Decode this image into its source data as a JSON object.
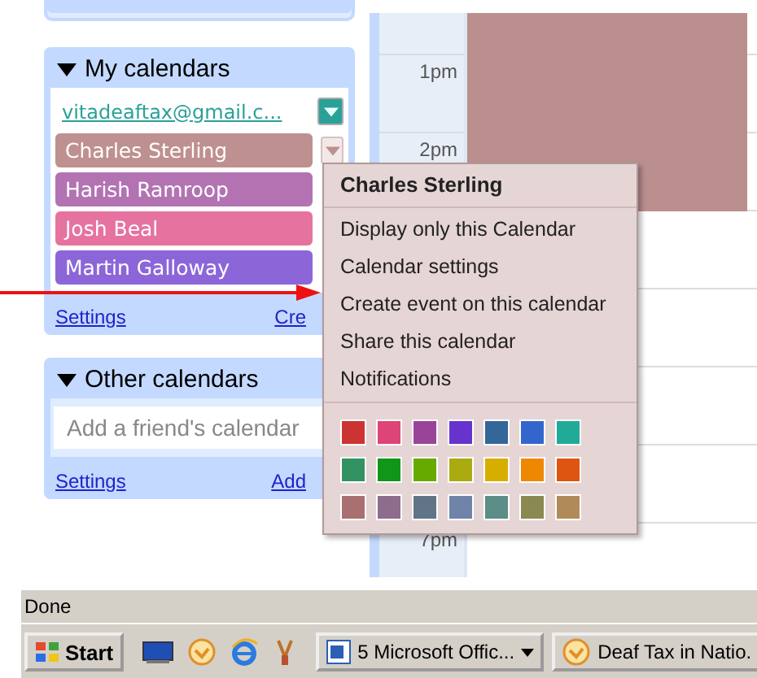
{
  "sidebar": {
    "my_calendars": {
      "title": "My calendars",
      "expanded": true,
      "items": [
        {
          "kind": "link",
          "name": "vitadeaftax@gmail.c...",
          "color": "#2aa198",
          "menu_open": false
        },
        {
          "kind": "chip",
          "name": "Charles Sterling",
          "color": "#bf9090",
          "menu_open": true
        },
        {
          "kind": "chip",
          "name": "Harish Ramroop",
          "color": "#b373b3"
        },
        {
          "kind": "chip",
          "name": "Josh Beal",
          "color": "#e6739f"
        },
        {
          "kind": "chip",
          "name": "Martin Galloway",
          "color": "#8c66d9"
        }
      ],
      "footer_links": [
        "Settings",
        "Cre"
      ]
    },
    "other_calendars": {
      "title": "Other calendars",
      "expanded": true,
      "placeholder": "Add a friend's calendar",
      "footer_links": [
        "Settings",
        "Add"
      ]
    }
  },
  "calendar": {
    "time_labels": [
      "1pm",
      "2pm",
      "7pm"
    ]
  },
  "menu": {
    "title": "Charles Sterling",
    "items": [
      "Display only this Calendar",
      "Calendar settings",
      "Create event on this calendar",
      "Share this calendar",
      "Notifications"
    ],
    "swatches": [
      [
        {
          "color": "#cc3333"
        },
        {
          "color": "#dd4477"
        },
        {
          "color": "#994499"
        },
        {
          "color": "#6633cc"
        },
        {
          "color": "#336699"
        },
        {
          "color": "#3366cc"
        },
        {
          "color": "#22aa99"
        }
      ],
      [
        {
          "color": "#329262"
        },
        {
          "color": "#109618"
        },
        {
          "color": "#66aa00"
        },
        {
          "color": "#aaaa11"
        },
        {
          "color": "#d6ae00"
        },
        {
          "color": "#ee8800"
        },
        {
          "color": "#dd5511"
        }
      ],
      [
        {
          "color": "#a87070"
        },
        {
          "color": "#8c6d8c"
        },
        {
          "color": "#627487"
        },
        {
          "color": "#7083a8"
        },
        {
          "color": "#5c8d87"
        },
        {
          "color": "#898951"
        },
        {
          "color": "#b08b59"
        }
      ]
    ]
  },
  "status_bar": {
    "text": "Done"
  },
  "taskbar": {
    "start": "Start",
    "tasks": [
      {
        "kind": "group",
        "label": "5 Microsoft Offic..."
      },
      {
        "kind": "single",
        "label": "Deaf Tax in Natio."
      }
    ]
  }
}
